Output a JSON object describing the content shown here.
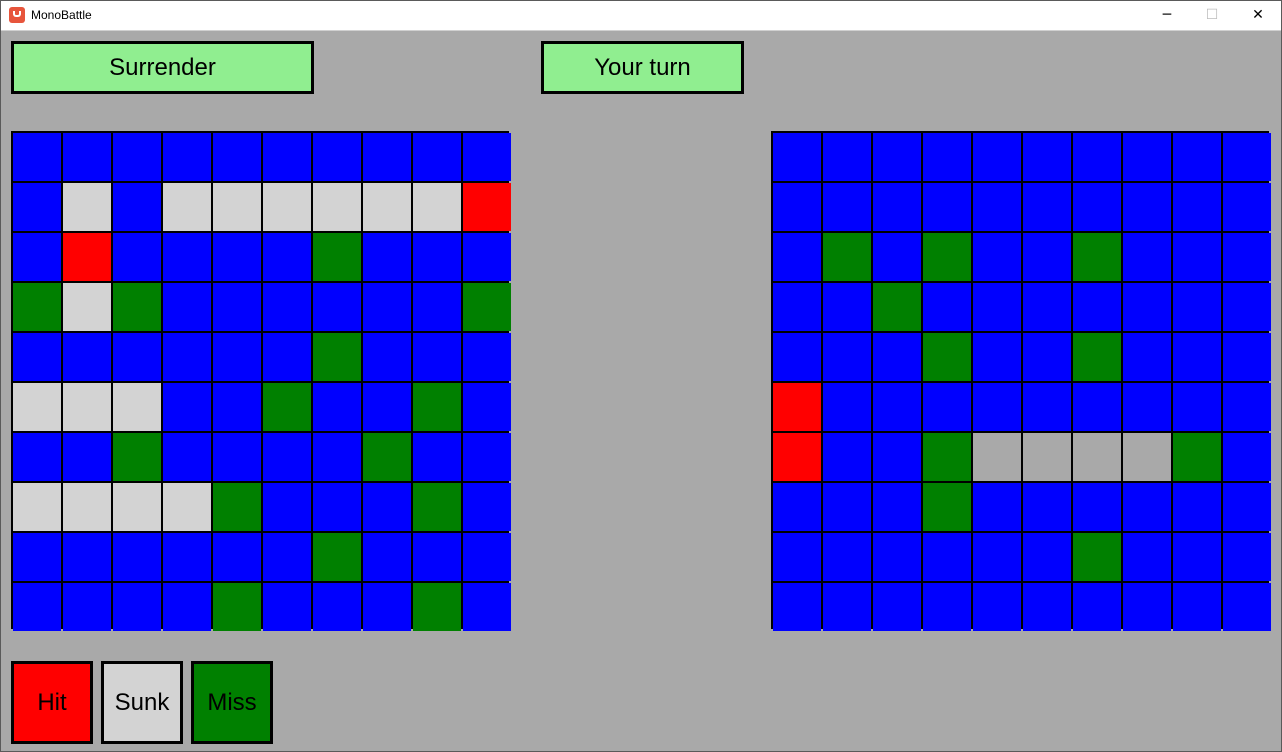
{
  "window": {
    "title": "MonoBattle",
    "minimize_glyph": "─",
    "maximize_glyph": "☐",
    "close_glyph": "✕"
  },
  "controls": {
    "surrender_label": "Surrender",
    "turn_label": "Your turn"
  },
  "colors": {
    "water": "#0000ff",
    "hit": "#ff0000",
    "sunk_own": "#d3d3d3",
    "sunk_enemy": "#a9a9a9",
    "miss": "#008000",
    "button": "#90ee90",
    "background": "#a9a9a9"
  },
  "legend": [
    {
      "label": "Hit",
      "color": "#ff0000"
    },
    {
      "label": "Sunk",
      "color": "#d3d3d3"
    },
    {
      "label": "Miss",
      "color": "#008000"
    }
  ],
  "player_board": [
    "WWWWWWWWWW",
    "WSWSSSSSSH",
    "WHWWWWMWWW",
    "MSMWWWWWWM",
    "WWWWWWMWWW",
    "SSSWWMWWMW",
    "WWMWWWWMWW",
    "SSSSMWWWMW",
    "WWWWWWMWWW",
    "WWWWMWWWMW"
  ],
  "enemy_board": [
    "WWWWWWWWWW",
    "WWWWWWWWWW",
    "WMWMWWMWWW",
    "WWMWWWWWWW",
    "WWWMWWMWWW",
    "HWWWWWWWWW",
    "HWWMSSSSMW",
    "WWWMWWWWWW",
    "WWWWWWMWWW",
    "WWWWWWWWWW"
  ]
}
